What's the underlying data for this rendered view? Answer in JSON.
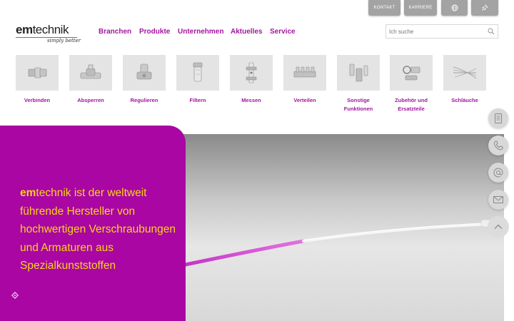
{
  "top_buttons": {
    "kontakt": "KONTAKT",
    "karriere": "KARRIERE",
    "language_icon": "globe-icon",
    "pin_icon": "pin-icon"
  },
  "logo": {
    "bold": "em",
    "rest": "technik",
    "tagline": "simply better"
  },
  "nav": [
    "Branchen",
    "Produkte",
    "Unternehmen",
    "Aktuelles",
    "Service"
  ],
  "search": {
    "placeholder": "Ich suche",
    "icon": "search-icon"
  },
  "categories": [
    {
      "label": "Verbinden",
      "icon": "connector-icon"
    },
    {
      "label": "Absperren",
      "icon": "valve-icon"
    },
    {
      "label": "Regulieren",
      "icon": "regulator-icon"
    },
    {
      "label": "Filtern",
      "icon": "filter-icon"
    },
    {
      "label": "Messen",
      "icon": "flowmeter-icon"
    },
    {
      "label": "Verteilen",
      "icon": "manifold-icon"
    },
    {
      "label": "Sonstige Funktionen",
      "icon": "misc-fittings-icon"
    },
    {
      "label": "Zubehör und Ersatzteile",
      "icon": "accessories-icon"
    },
    {
      "label": "Schläuche",
      "icon": "tubing-icon"
    }
  ],
  "hero": {
    "brand_bold": "em",
    "text": "technik ist der weltweit führende Hersteller von hochwertigen Verschraubungen und Armaturen aus Spezialkunststoffen"
  },
  "side_buttons": [
    "document-icon",
    "phone-icon",
    "at-icon",
    "mail-icon",
    "chevron-up-icon"
  ],
  "colors": {
    "brand": "#a906a3",
    "accent_text": "#f6d31b",
    "nav": "#a3169f",
    "tile": "#e4e4e4"
  }
}
